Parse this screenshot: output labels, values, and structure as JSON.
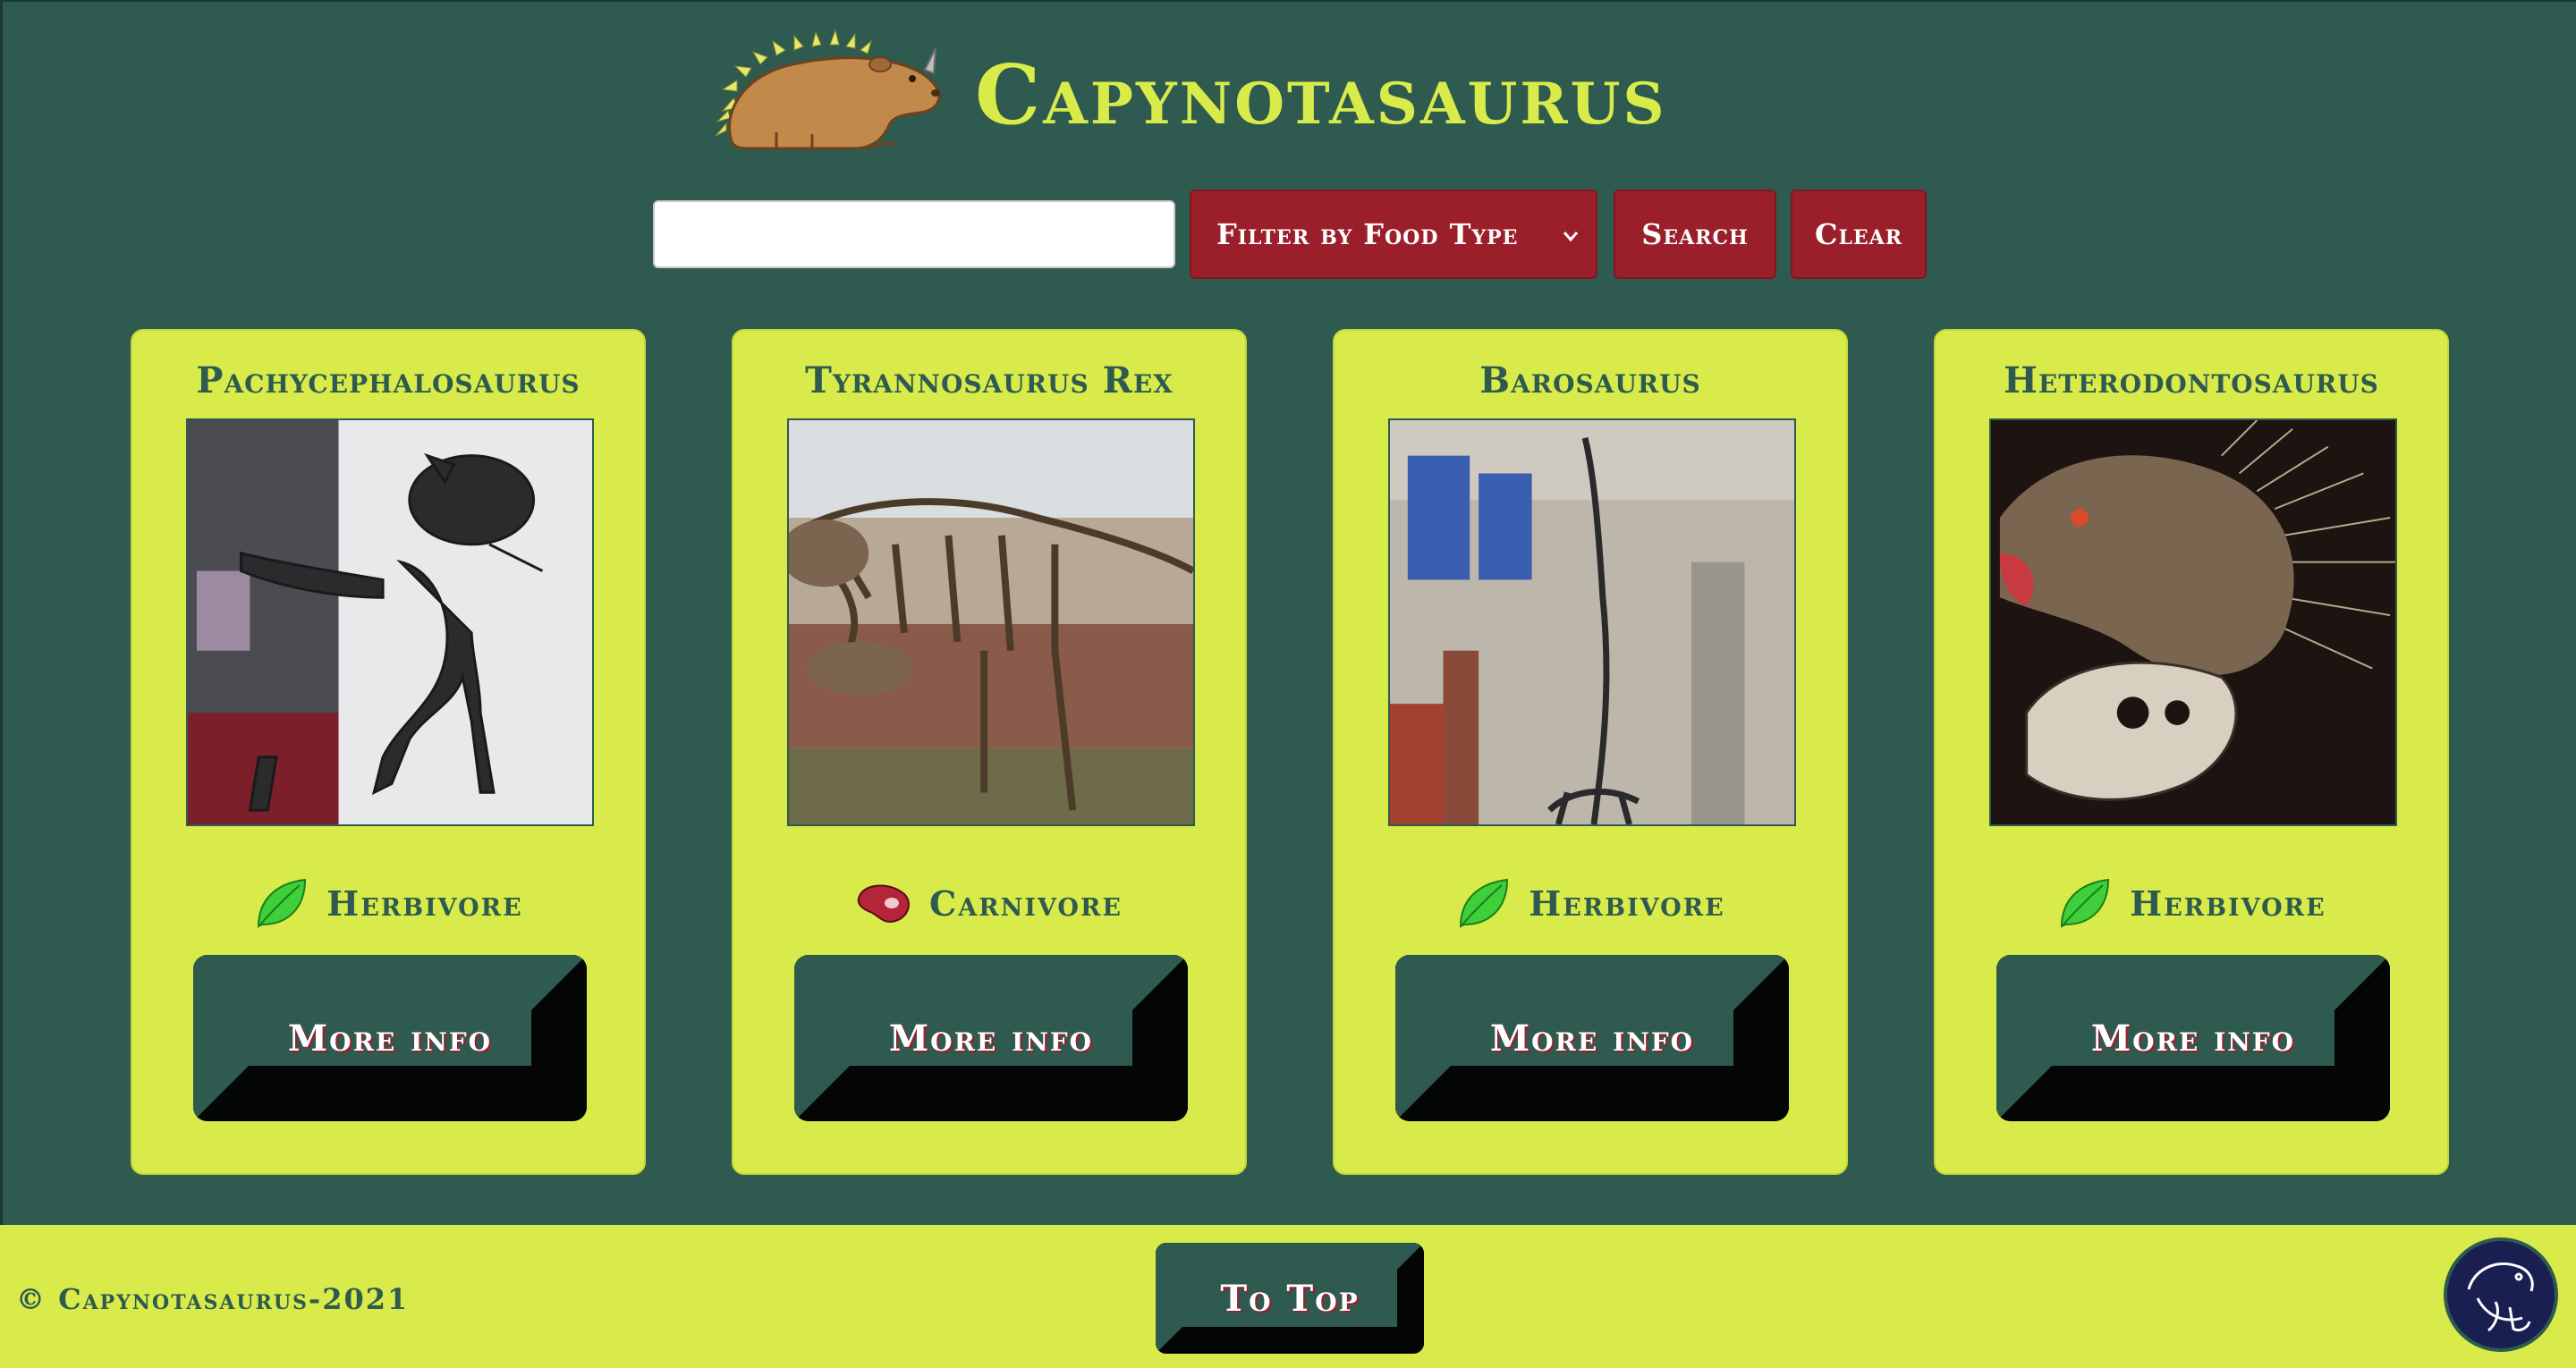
{
  "site": {
    "title": "Capynotasaurus",
    "logo_icon": "capybara-dino-logo"
  },
  "search": {
    "input_value": "",
    "input_placeholder": "",
    "filter_label": "Filter by Food Type",
    "search_label": "Search",
    "clear_label": "Clear"
  },
  "cards": [
    {
      "name": "Pachycephalosaurus",
      "diet": "Herbivore",
      "diet_icon": "leaf-icon",
      "button": "More info"
    },
    {
      "name": "Tyrannosaurus Rex",
      "diet": "Carnivore",
      "diet_icon": "meat-steak-icon",
      "button": "More info"
    },
    {
      "name": "Barosaurus",
      "diet": "Herbivore",
      "diet_icon": "leaf-icon",
      "button": "More info"
    },
    {
      "name": "Heterodontosaurus",
      "diet": "Herbivore",
      "diet_icon": "leaf-icon",
      "button": "More info"
    }
  ],
  "footer": {
    "copyright": "© Capynotasaurus-2021",
    "to_top_label": "To Top",
    "badge_icon": "capybara-badge-icon"
  },
  "colors": {
    "background": "#2e5a4f",
    "accent_yellow": "#d8eb4a",
    "button_red": "#9b1f2a",
    "button_green": "#2e5a4f"
  }
}
